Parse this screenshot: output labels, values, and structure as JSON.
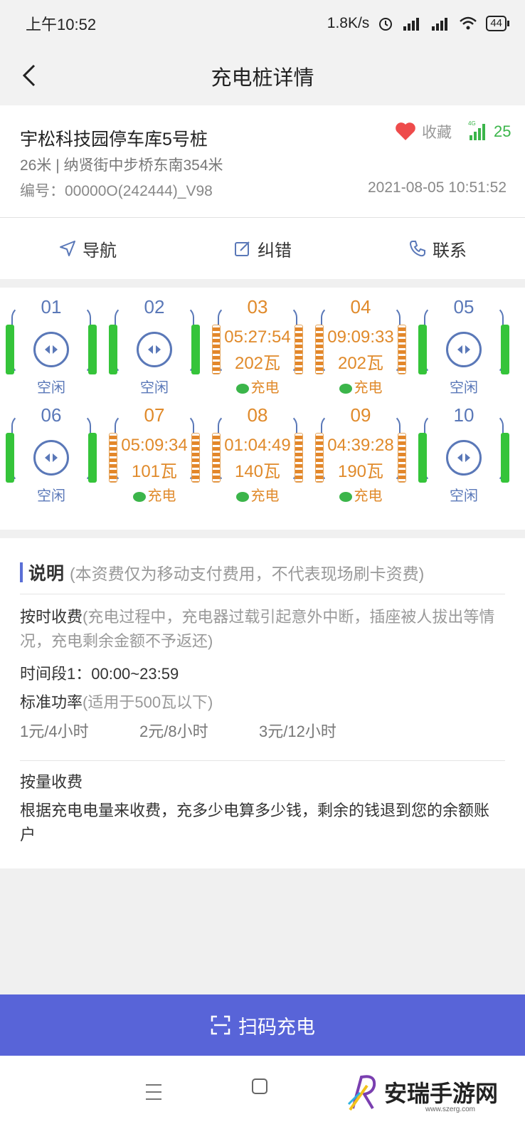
{
  "status_bar": {
    "time": "上午10:52",
    "speed": "1.8K/s",
    "battery": "44"
  },
  "header": {
    "title": "充电桩详情"
  },
  "station": {
    "name": "宇松科技园停车库5号桩",
    "favorite_label": "收藏",
    "signal_type": "4G",
    "signal_value": "25",
    "address": "26米 | 纳贤街中步桥东南354米",
    "code": "编号：00000O(242444)_V98",
    "datetime": "2021-08-05 10:51:52"
  },
  "actions": [
    {
      "label": "导航"
    },
    {
      "label": "纠错"
    },
    {
      "label": "联系"
    }
  ],
  "piles": [
    {
      "num": "01",
      "status": "空闲"
    },
    {
      "num": "02",
      "status": "空闲"
    },
    {
      "num": "03",
      "status": "充电",
      "time": "05:27:54",
      "power": "202瓦"
    },
    {
      "num": "04",
      "status": "充电",
      "time": "09:09:33",
      "power": "202瓦"
    },
    {
      "num": "05",
      "status": "空闲"
    },
    {
      "num": "06",
      "status": "空闲"
    },
    {
      "num": "07",
      "status": "充电",
      "time": "05:09:34",
      "power": "101瓦"
    },
    {
      "num": "08",
      "status": "充电",
      "time": "01:04:49",
      "power": "140瓦"
    },
    {
      "num": "09",
      "status": "充电",
      "time": "04:39:28",
      "power": "190瓦"
    },
    {
      "num": "10",
      "status": "空闲"
    }
  ],
  "description": {
    "title": "说明",
    "note": "(本资费仅为移动支付费用，不代表现场刷卡资费)",
    "timed_title": "按时收费",
    "timed_note": "(充电过程中，充电器过载引起意外中断，插座被人拔出等情况，充电剩余金额不予返还)",
    "period": "时间段1：00:00~23:59",
    "standard_power": "标准功率",
    "standard_note": "(适用于500瓦以下)",
    "prices": [
      "1元/4小时",
      "2元/8小时",
      "3元/12小时"
    ],
    "energy_title": "按量收费",
    "energy_text": "根据充电电量来收费，充多少电算多少钱，剩余的钱退到您的余额账户"
  },
  "scan_button": {
    "label": "扫码充电"
  },
  "watermark": {
    "brand": "安瑞手游网",
    "url": "www.szerg.com"
  },
  "colors": {
    "accent": "#5864d8",
    "idle": "#5a78b8",
    "charging": "#e08a2b",
    "green": "#35c43a"
  }
}
